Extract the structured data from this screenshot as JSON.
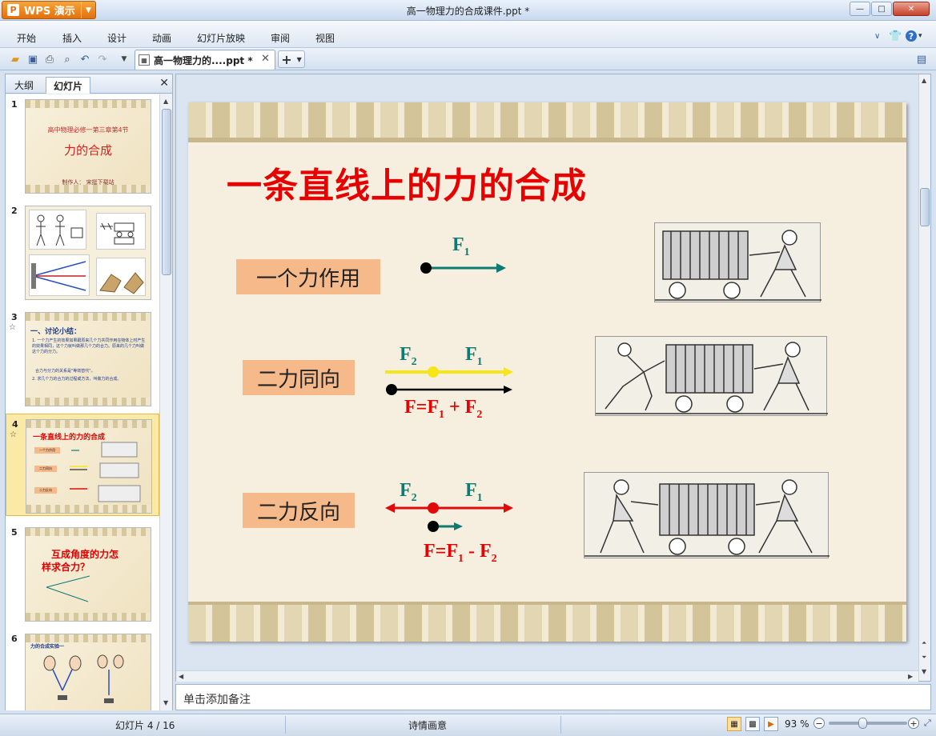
{
  "app": {
    "button_label": "WPS 演示",
    "window_title": "高一物理力的合成课件.ppt *"
  },
  "menu": {
    "items": [
      "开始",
      "插入",
      "设计",
      "动画",
      "幻灯片放映",
      "审阅",
      "视图"
    ]
  },
  "toolbar": {
    "doc_tab_label": "高一物理力的....ppt *"
  },
  "left_pane": {
    "tab_outline": "大纲",
    "tab_slides": "幻灯片",
    "thumbnails": [
      {
        "num": "1",
        "line1": "高中物理必修一第三章第4节",
        "line2": "力的合成",
        "line3": "制作人：  宋挺下载站"
      },
      {
        "num": "2"
      },
      {
        "num": "3",
        "title": "一、讨论小结：",
        "text1": "1. 一个力产生的效果如果跟原来几个力共同作用在物体上时产生的效果相同，这个力就叫做那几个力的合力。原来的几个力叫做这个力的分力。",
        "text2": "合力与分力的关系是\"等效替代\"。",
        "text3": "2. 求几个力的合力的过程或方法，叫做力的合成。"
      },
      {
        "num": "4",
        "title": "一条直线上的力的合成",
        "r1": "一个力作用",
        "r2": "二力同向",
        "r3": "二力反向"
      },
      {
        "num": "5",
        "line1": "互成角度的力怎",
        "line2": "样求合力？"
      },
      {
        "num": "6",
        "title": "力的合成实验一"
      }
    ]
  },
  "slide": {
    "title": "一条直线上的力的合成",
    "row1_label": "一个力作用",
    "row2_label": "二力同向",
    "row3_label": "二力反向",
    "f": "F",
    "sub1": "1",
    "sub2": "2",
    "eq_same_prefix": "F=F",
    "eq_same_mid": " + F",
    "eq_opp_prefix": "F=F",
    "eq_opp_mid": " - F"
  },
  "notes_placeholder": "单击添加备注",
  "status": {
    "slide_counter": "幻灯片 4 / 16",
    "theme_name": "诗情画意",
    "zoom": "93 %"
  },
  "colors": {
    "title_red": "#e60000",
    "teal_arrow": "#0e7a72",
    "yellow_arrow": "#f5e61a",
    "red_arrow": "#e10a0a",
    "label_box": "#f6b98a"
  }
}
